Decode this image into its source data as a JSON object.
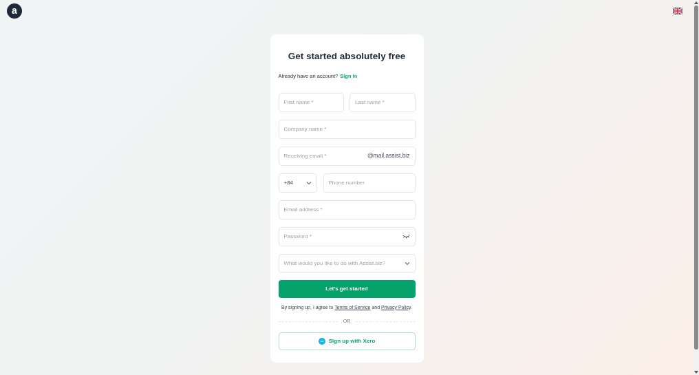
{
  "logo": "a",
  "title": "Get started absolutely free",
  "signin_prompt": "Already have an account?",
  "signin_link": "Sign in",
  "fields": [
    {
      "kind": "pair",
      "items": [
        {
          "placeholder": "First name *"
        },
        {
          "placeholder": "Last name *"
        }
      ]
    },
    {
      "kind": "text",
      "placeholder": "Company name *"
    },
    {
      "kind": "suffix",
      "placeholder": "Receiving email *",
      "suffix": "@mail.assist.biz"
    },
    {
      "kind": "phone",
      "code": "+84",
      "placeholder": "Phone number"
    },
    {
      "kind": "text",
      "placeholder": "Email address *"
    },
    {
      "kind": "password",
      "placeholder": "Password *"
    },
    {
      "kind": "select",
      "placeholder": "What would you like to do with Assist.biz?"
    }
  ],
  "submit": "Let's get started",
  "terms": {
    "before": "By signing up, I agree to",
    "terms_link": "Terms of Service",
    "middle": "and",
    "privacy_link": "Privacy Policy",
    "after": "."
  },
  "divider": "OR",
  "xero_button": "Sign up with Xero"
}
